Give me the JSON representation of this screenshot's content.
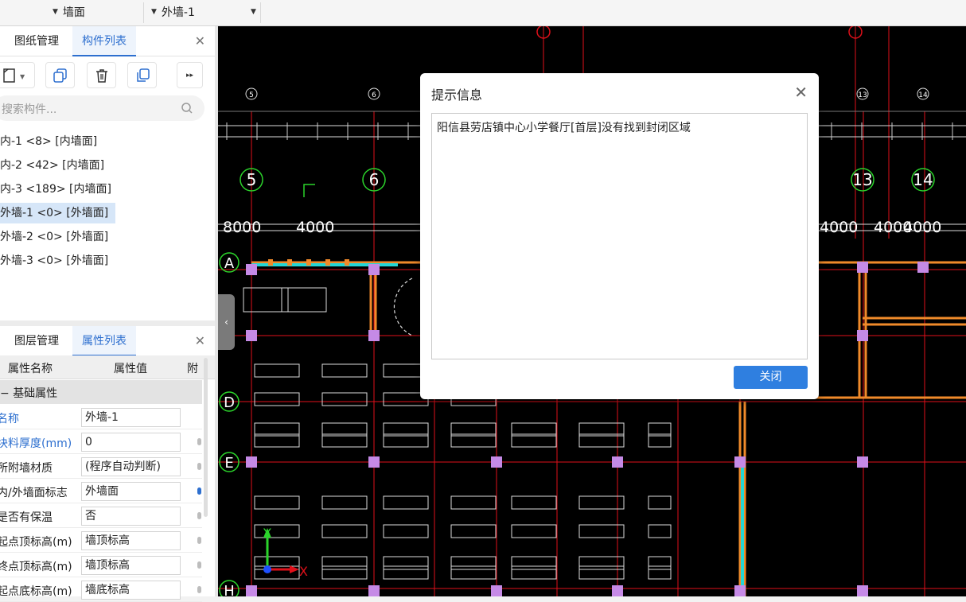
{
  "topbar": {
    "dropdown1": {
      "value": "墙面"
    },
    "dropdown2": {
      "value": "外墙-1"
    }
  },
  "upper_panel": {
    "tabs": [
      {
        "label": "图纸管理",
        "active": false
      },
      {
        "label": "构件列表",
        "active": true
      }
    ],
    "toolbar_icons": [
      "new-icon",
      "copy-icon",
      "delete-icon",
      "duplicate-icon",
      "more-icon"
    ],
    "search": {
      "placeholder": "搜索构件..."
    },
    "items": [
      {
        "label": "内-1 <8> [内墙面]",
        "selected": false
      },
      {
        "label": "内-2 <42> [内墙面]",
        "selected": false
      },
      {
        "label": "内-3 <189> [内墙面]",
        "selected": false
      },
      {
        "label": "外墙-1 <0> [外墙面]",
        "selected": true
      },
      {
        "label": "外墙-2 <0> [外墙面]",
        "selected": false
      },
      {
        "label": "外墙-3 <0> [外墙面]",
        "selected": false
      }
    ]
  },
  "lower_panel": {
    "tabs": [
      {
        "label": "图层管理",
        "active": false
      },
      {
        "label": "属性列表",
        "active": true
      }
    ],
    "columns": [
      "属性名称",
      "属性值",
      "附"
    ],
    "group": "基础属性",
    "rows": [
      {
        "name": "名称",
        "value": "外墙-1",
        "highlight": true
      },
      {
        "name": "块料厚度(mm)",
        "value": "0",
        "highlight": true
      },
      {
        "name": "所附墙材质",
        "value": "(程序自动判断)",
        "highlight": false
      },
      {
        "name": "内/外墙面标志",
        "value": "外墙面",
        "highlight": false
      },
      {
        "name": "是否有保温",
        "value": "否",
        "highlight": false
      },
      {
        "name": "起点顶标高(m)",
        "value": "墙顶标高",
        "highlight": false
      },
      {
        "name": "终点顶标高(m)",
        "value": "墙顶标高",
        "highlight": false
      },
      {
        "name": "起点底标高(m)",
        "value": "墙底标高",
        "highlight": false
      }
    ]
  },
  "cad": {
    "axis_labels": [
      "5",
      "6",
      "13",
      "14",
      "A",
      "D",
      "E",
      "H"
    ],
    "small_axis_labels": [
      "5",
      "6",
      "13",
      "14"
    ],
    "dimension_text": [
      "8000",
      "4000",
      "4000",
      "4000"
    ],
    "axis_x": "X",
    "axis_y": "Y",
    "colors": {
      "background": "#000000",
      "grid": "#e0101a",
      "wall": "#f08a2a",
      "column": "#c58ae6",
      "furniture": "#ffffff",
      "cyan": "#22d6d6",
      "green": "#2bd42b"
    }
  },
  "dialog": {
    "title": "提示信息",
    "message": "阳信县劳店镇中心小学餐厅[首层]没有找到封闭区域",
    "close_button": "关闭"
  }
}
